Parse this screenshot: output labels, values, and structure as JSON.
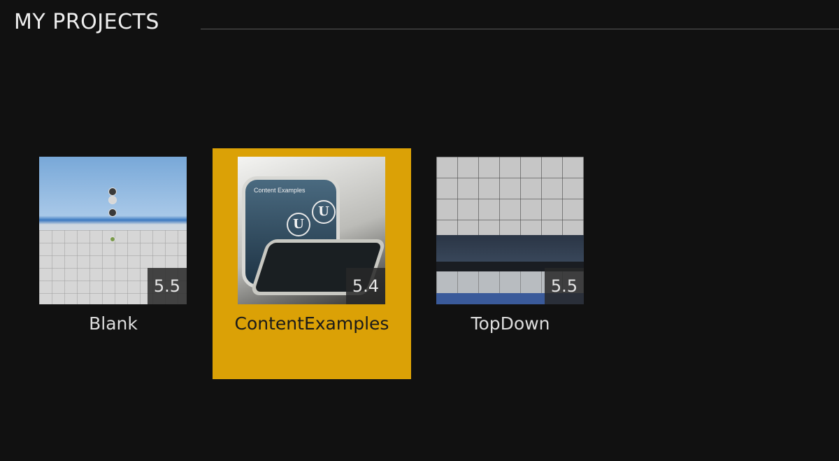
{
  "header": {
    "title": "MY PROJECTS"
  },
  "projects": [
    {
      "name": "Blank",
      "version": "5.5",
      "selected": false
    },
    {
      "name": "ContentExamples",
      "version": "5.4",
      "selected": true,
      "thumbnail_text": "Content Examples"
    },
    {
      "name": "TopDown",
      "version": "5.5",
      "selected": false
    }
  ],
  "colors": {
    "background": "#111111",
    "selection": "#dba106",
    "title_text": "#eeeeee"
  }
}
